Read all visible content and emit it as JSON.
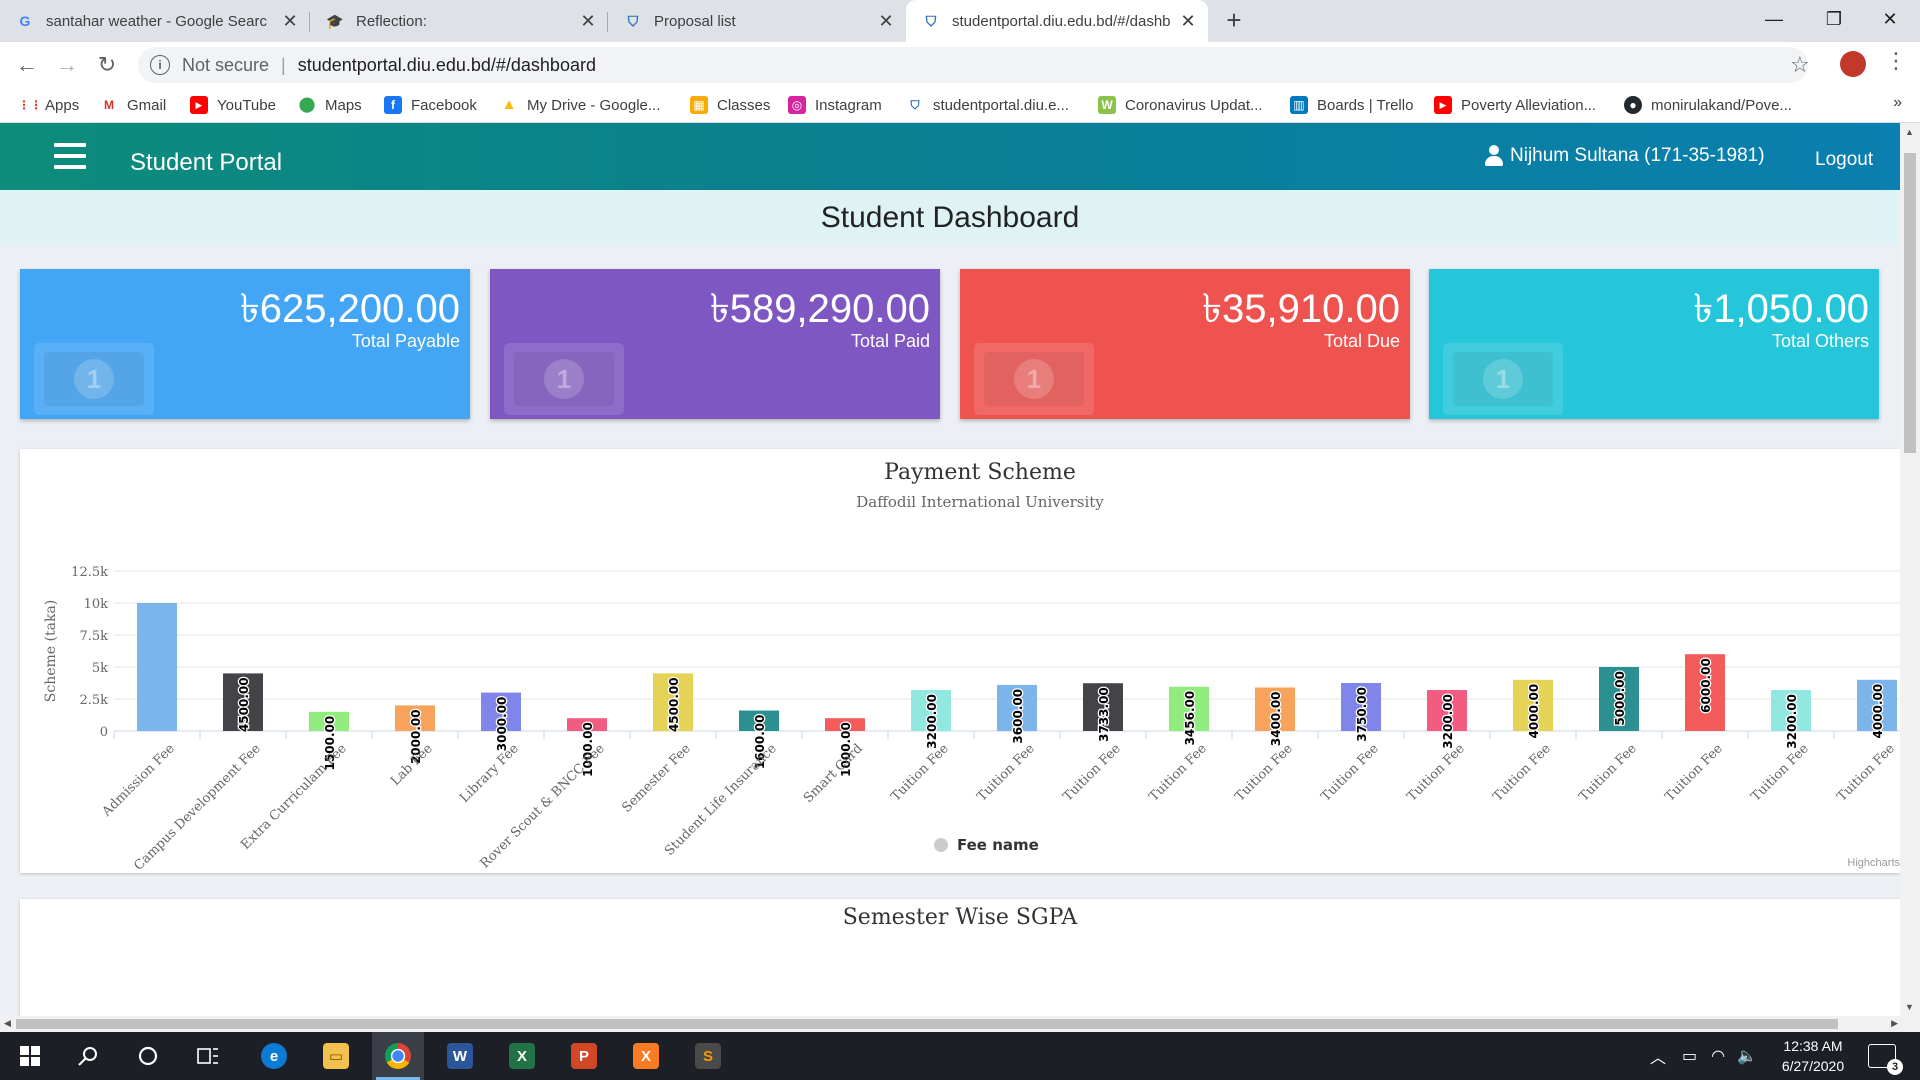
{
  "browser": {
    "tabs": [
      {
        "title": "santahar weather - Google Searc",
        "icon": "google-icon"
      },
      {
        "title": "Reflection:",
        "icon": "cap-icon"
      },
      {
        "title": "Proposal list",
        "icon": "diu-shield-icon"
      },
      {
        "title": "studentportal.diu.edu.bd/#/dashb",
        "icon": "diu-shield-icon"
      }
    ],
    "new_tab": "+",
    "security": "Not secure",
    "url": "studentportal.diu.edu.bd/#/dashboard",
    "bookmarks": [
      "Apps",
      "Gmail",
      "YouTube",
      "Maps",
      "Facebook",
      "My Drive - Google...",
      "Classes",
      "Instagram",
      "studentportal.diu.e...",
      "Coronavirus Updat...",
      "Boards | Trello",
      "Poverty Alleviation...",
      "monirulakand/Pove..."
    ],
    "bookmarks_more": "»"
  },
  "app": {
    "brand": "Student Portal",
    "user": "Nijhum Sultana (171-35-1981)",
    "logout": "Logout",
    "page_title": "Student Dashboard"
  },
  "cards": [
    {
      "amount": "৳625,200.00",
      "label": "Total Payable",
      "color": "#42a5f5"
    },
    {
      "amount": "৳589,290.00",
      "label": "Total Paid",
      "color": "#7e57c2"
    },
    {
      "amount": "৳35,910.00",
      "label": "Total Due",
      "color": "#ef5350"
    },
    {
      "amount": "৳1,050.00",
      "label": "Total Others",
      "color": "#26c6da"
    }
  ],
  "chart_data": {
    "type": "bar",
    "title": "Payment Scheme",
    "subtitle": "Daffodil International University",
    "ylabel": "Scheme (taka)",
    "ylim": [
      0,
      12500
    ],
    "yticks": [
      "0",
      "2.5k",
      "5k",
      "7.5k",
      "10k",
      "12.5k"
    ],
    "grid": true,
    "legend": {
      "position": "bottom-center",
      "label": "Fee name"
    },
    "categories": [
      "Admission Fee",
      "Campus Development Fee",
      "Extra Curriculam Fee",
      "Lab Fee",
      "Library Fee",
      "Rover Scout & BNCC Fee",
      "Semester Fee",
      "Student Life Insurance",
      "Smart Card",
      "Tuition Fee",
      "Tuition Fee",
      "Tuition Fee",
      "Tuition Fee",
      "Tuition Fee",
      "Tuition Fee",
      "Tuition Fee",
      "Tuition Fee",
      "Tuition Fee",
      "Tuition Fee",
      "Tuition Fee",
      "Tuition Fee"
    ],
    "values": [
      10000,
      4500,
      1500,
      2000,
      3000,
      1000,
      4500,
      1600,
      1000,
      3200,
      3600,
      3733,
      3456,
      3400,
      3750,
      3200,
      4000,
      5000,
      6000,
      3200,
      4000
    ],
    "data_labels": [
      "",
      "4500.00",
      "1500.00",
      "2000.00",
      "3000.00",
      "1000.00",
      "4500.00",
      "1600.00",
      "1000.00",
      "3200.00",
      "3600.00",
      "3733.00",
      "3456.00",
      "3400.00",
      "3750.00",
      "3200.00",
      "4000.00",
      "5000.00",
      "6000.00",
      "3200.00",
      "4000.00"
    ],
    "colors": [
      "#7cb5ec",
      "#434348",
      "#90ed7d",
      "#f7a35c",
      "#8085e9",
      "#f15c80",
      "#e4d354",
      "#2b908f",
      "#f45b5b",
      "#91e8e1",
      "#7cb5ec",
      "#434348",
      "#90ed7d",
      "#f7a35c",
      "#8085e9",
      "#f15c80",
      "#e4d354",
      "#2b908f",
      "#f45b5b",
      "#91e8e1",
      "#7cb5ec"
    ],
    "credit": "Highcharts"
  },
  "next_section": "Semester Wise SGPA",
  "taskbar": {
    "time": "12:38 AM",
    "date": "6/27/2020",
    "notifications": "3"
  }
}
